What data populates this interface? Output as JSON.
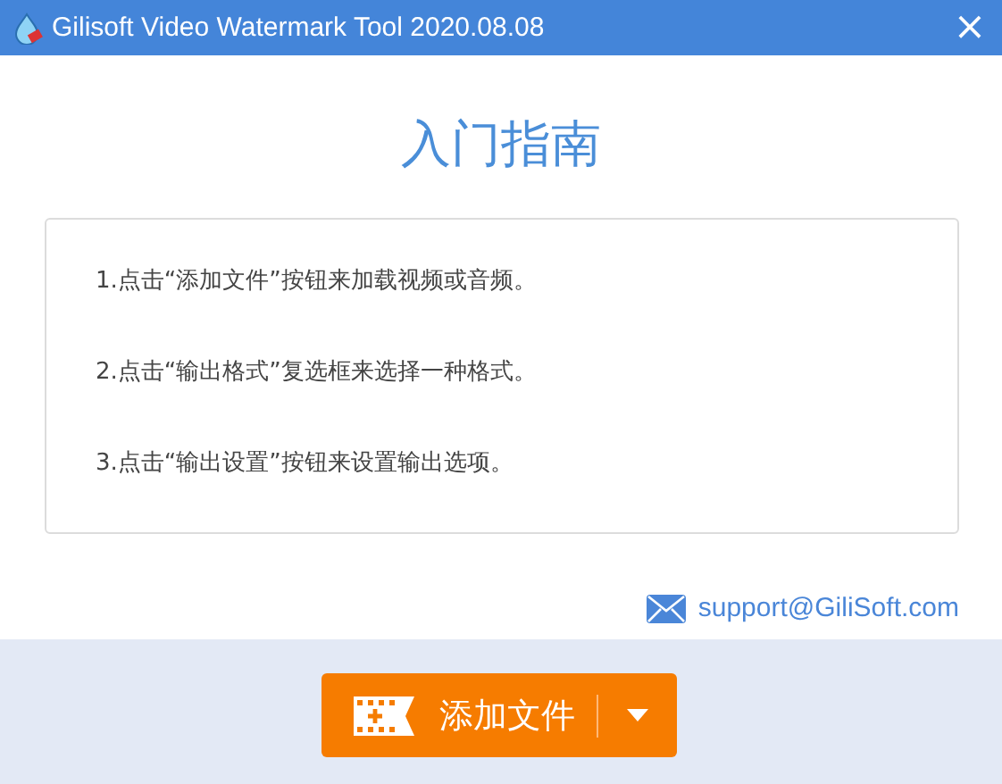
{
  "window": {
    "title": "Gilisoft Video Watermark Tool 2020.08.08",
    "close": "×"
  },
  "guide": {
    "heading": "入门指南",
    "steps": [
      "1.点击“添加文件”按钮来加载视频或音频。",
      "2.点击“输出格式”复选框来选择一种格式。",
      "3.点击“输出设置”按钮来设置输出选项。"
    ]
  },
  "support": {
    "email": "support@GiliSoft.com"
  },
  "add_button": {
    "label": "添加文件"
  }
}
